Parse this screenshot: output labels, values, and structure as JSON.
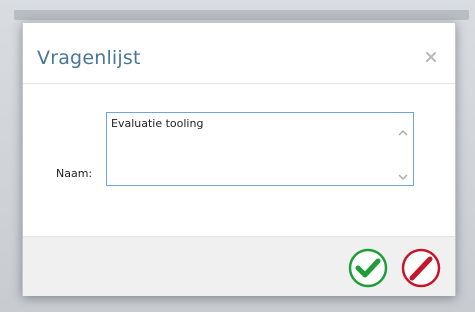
{
  "dialog": {
    "title": "Vragenlijst",
    "close_icon": "close-icon",
    "field": {
      "label": "Naam:",
      "value": "Evaluatie tooling"
    },
    "actions": {
      "confirm_icon": "checkmark-icon",
      "cancel_icon": "pencil-slash-icon"
    }
  },
  "colors": {
    "title": "#4a7696",
    "input_border": "#6ea6d8",
    "confirm": "#1f9d3b",
    "cancel": "#c4182a",
    "footer_bg": "#f0f0f0"
  }
}
